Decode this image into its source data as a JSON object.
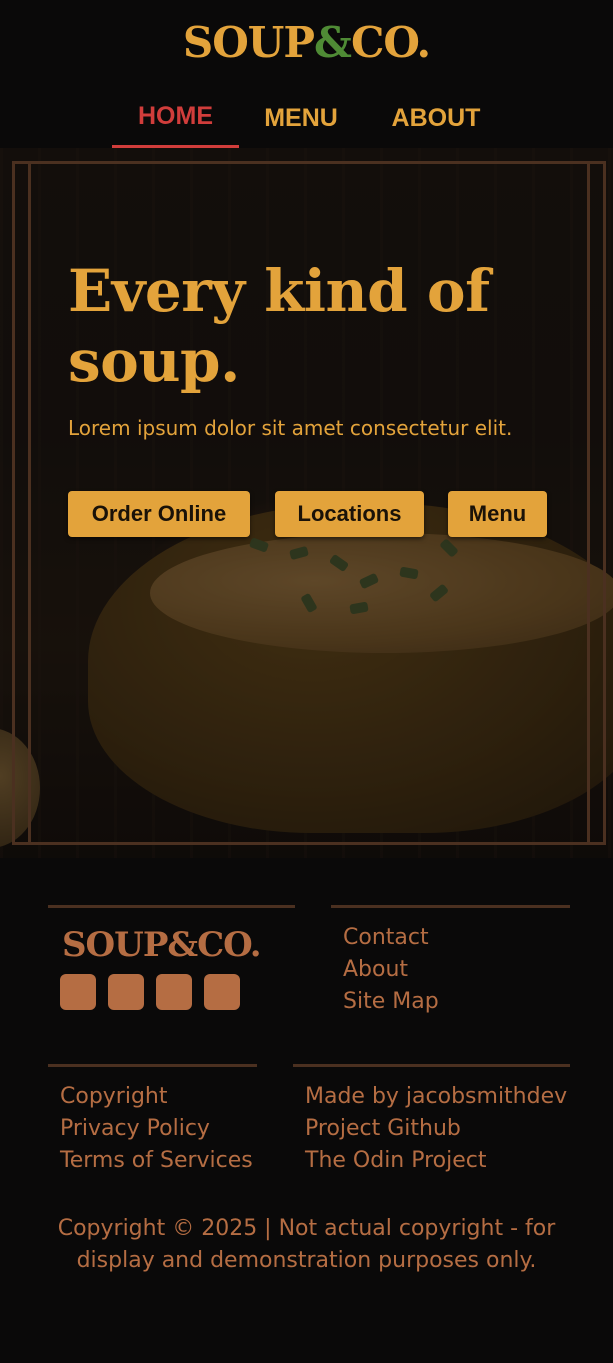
{
  "brand": {
    "logo_word1": "SOUP",
    "logo_amp": "&",
    "logo_word2": "CO.",
    "accent": "#e3a33b",
    "amp_color": "#4f8b35"
  },
  "nav": {
    "items": [
      {
        "label": "HOME",
        "active": true
      },
      {
        "label": "MENU",
        "active": false
      },
      {
        "label": "ABOUT",
        "active": false
      }
    ],
    "active_color": "#d13d3b"
  },
  "hero": {
    "title": "Every kind of soup.",
    "subtitle": "Lorem ipsum dolor sit amet consectetur elit.",
    "buttons": [
      {
        "label": "Order Online"
      },
      {
        "label": "Locations"
      },
      {
        "label": "Menu"
      }
    ]
  },
  "footer": {
    "logo": "SOUP&CO.",
    "social_icons": [
      "social-icon-1",
      "social-icon-2",
      "social-icon-3",
      "social-icon-4"
    ],
    "links_right": [
      "Contact",
      "About",
      "Site Map"
    ],
    "links_legal": [
      "Copyright",
      "Privacy Policy",
      "Terms of Services"
    ],
    "links_credits": [
      "Made by jacobsmithdev",
      "Project Github",
      "The Odin Project"
    ],
    "copyright": "Copyright © 2025 | Not actual copyright - for display and demonstration purposes only.",
    "text_color": "#b56d43"
  }
}
